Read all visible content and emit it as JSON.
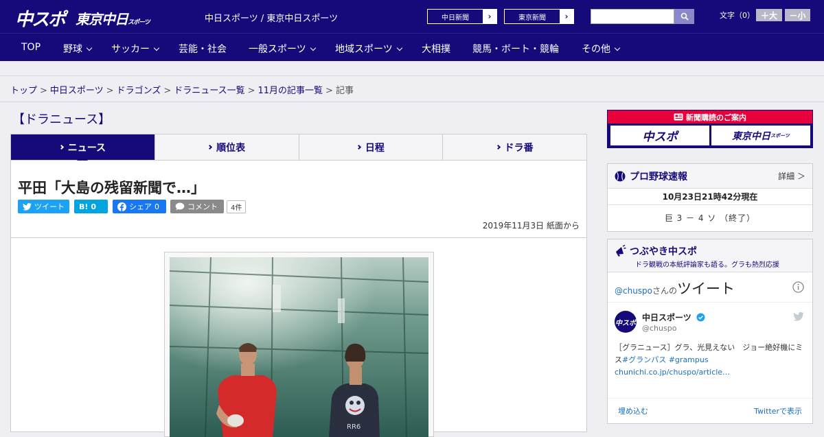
{
  "header": {
    "logo_chuspo": "中スポ",
    "logo_tokyo": "東京中日",
    "logo_tokyo_small": "スポーツ",
    "site_links": "中日スポーツ / 東京中日スポーツ",
    "paper_buttons": [
      "中日新聞",
      "東京新聞"
    ],
    "search_placeholder": "",
    "font_size_label": "文字（0）",
    "font_bigger": "＋大",
    "font_smaller": "－小"
  },
  "nav": [
    {
      "label": "TOP",
      "dropdown": false
    },
    {
      "label": "野球",
      "dropdown": true
    },
    {
      "label": "サッカー",
      "dropdown": true
    },
    {
      "label": "芸能・社会",
      "dropdown": false
    },
    {
      "label": "一般スポーツ",
      "dropdown": true
    },
    {
      "label": "地域スポーツ",
      "dropdown": true
    },
    {
      "label": "大相撲",
      "dropdown": false
    },
    {
      "label": "競馬・ボート・競輪",
      "dropdown": false
    },
    {
      "label": "その他",
      "dropdown": true
    }
  ],
  "breadcrumb": {
    "links": [
      "トップ",
      "中日スポーツ",
      "ドラゴンズ",
      "ドラニュース一覧",
      "11月の記事一覧"
    ],
    "current": "記事",
    "separator": ">"
  },
  "section_title": "【ドラニュース】",
  "tabs": [
    {
      "label": "ニュース",
      "active": true
    },
    {
      "label": "順位表",
      "active": false
    },
    {
      "label": "日程",
      "active": false
    },
    {
      "label": "ドラ番",
      "active": false
    }
  ],
  "article": {
    "headline": "平田「大島の残留新聞で…」",
    "share": {
      "tweet": "ツイート",
      "hatena_label": "B!",
      "hatena_count": "0",
      "fb": "シェア",
      "fb_count": "0",
      "comment": "コメント",
      "comment_count": "4件"
    },
    "date": "2019年11月3日 紙面から"
  },
  "sidebar": {
    "subscribe_title": "新聞購読のご案内",
    "subscribe_logos": [
      "中スポ",
      "東京中日"
    ],
    "subscribe_logo_small": "スポーツ",
    "baseball": {
      "title": "プロ野球速報",
      "more": "詳細 ＞",
      "time": "10月23日21時42分現在",
      "score": "巨 3 － 4 ソ （終了）"
    },
    "twitter_box": {
      "title": "つぶやき中スポ",
      "subtitle": "ドラ観戦の本紙評論家も語る。グラも熱烈応援",
      "handle_prefix": "@chuspo",
      "handle_suffix": "さんの",
      "widget_title": "ツイート",
      "avatar_text": "中スポ",
      "account_name": "中日スポーツ",
      "account_handle": "@chuspo",
      "tweet_plain_1": "［グラニュース］グラ、光見えない　ジョー絶好機にミス",
      "tweet_tag_1": "#グランパス",
      "tweet_tag_2": "#grampus",
      "tweet_link": "chunichi.co.jp/chuspo/article…",
      "embed": "埋め込む",
      "view_on": "Twitterで表示"
    }
  },
  "colors": {
    "brand_navy": "#160a7a",
    "accent_red": "#e8003a",
    "twitter_blue": "#1da1f2",
    "facebook_blue": "#1877f2",
    "hatena_blue": "#00a4de"
  }
}
